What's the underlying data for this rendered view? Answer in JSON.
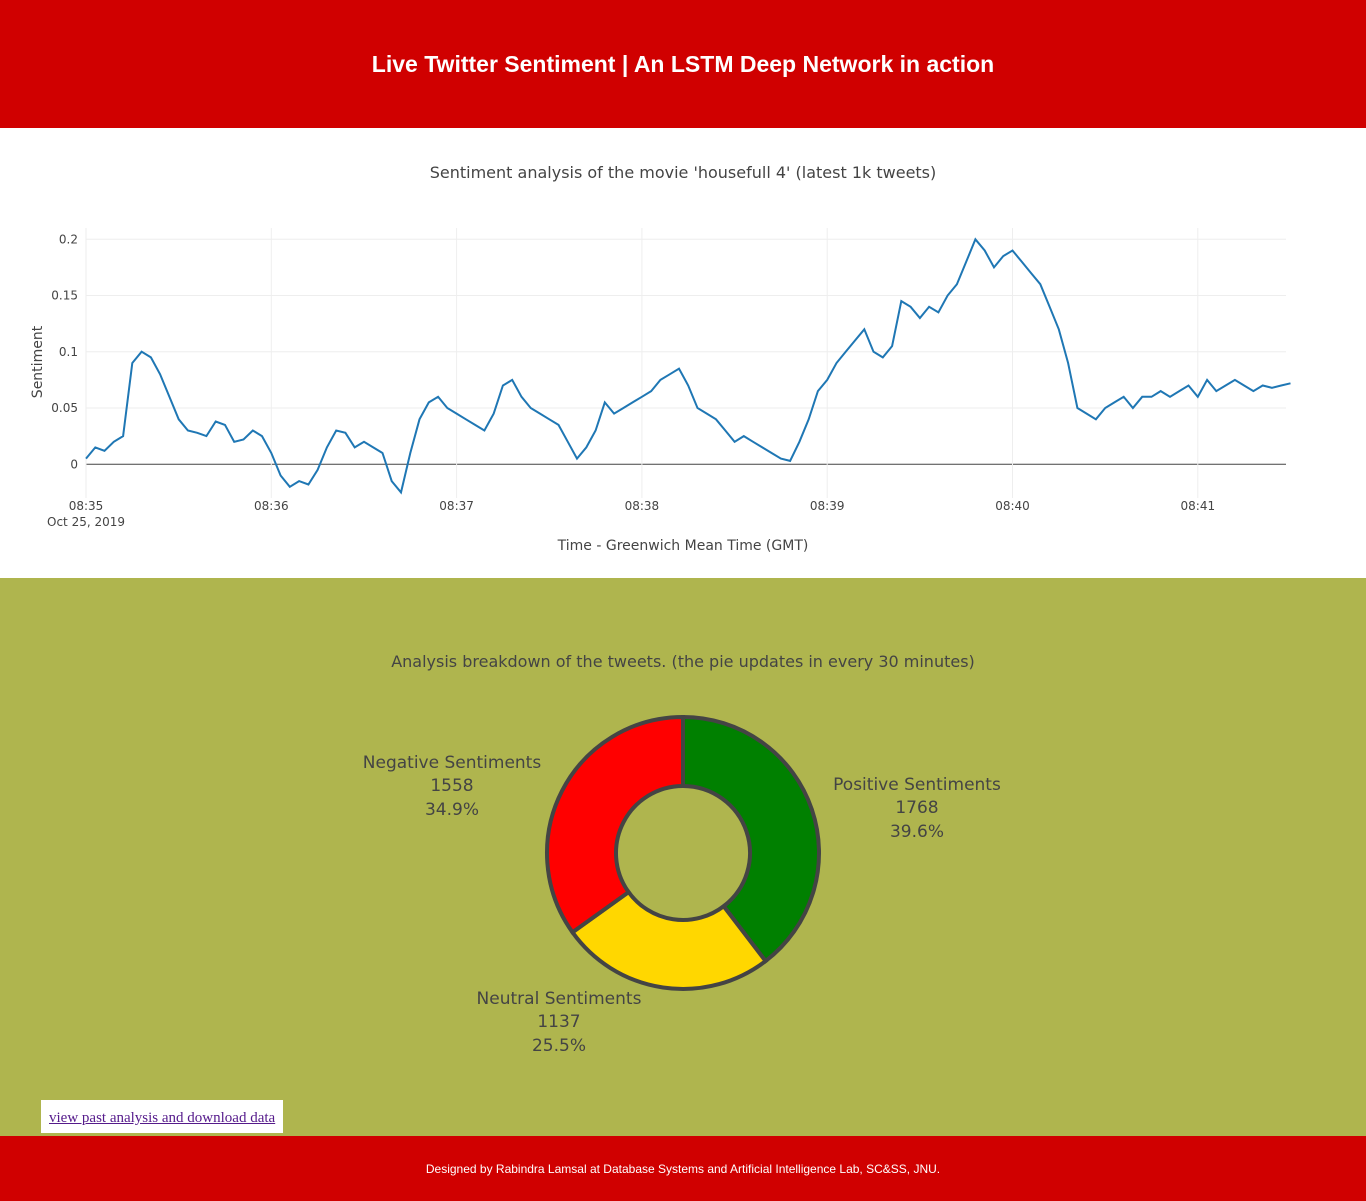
{
  "header": {
    "title": "Live Twitter Sentiment | An LSTM Deep Network in action"
  },
  "colors": {
    "header_bg": "#d00000",
    "line": "#1f77b4",
    "pie_section_bg": "#afb54e",
    "positive": "#008000",
    "neutral": "#ffd700",
    "negative": "#ff0000",
    "slice_border": "#444444"
  },
  "line_chart": {
    "title": "Sentiment analysis of the movie 'housefull 4' (latest 1k tweets)",
    "xlabel": "Time - Greenwich Mean Time (GMT)",
    "ylabel": "Sentiment",
    "date_label": "Oct 25, 2019",
    "xticks": [
      "08:35",
      "08:36",
      "08:37",
      "08:38",
      "08:39",
      "08:40",
      "08:41"
    ],
    "yticks": [
      "0",
      "0.05",
      "0.1",
      "0.15",
      "0.2"
    ]
  },
  "pie_chart": {
    "title": "Analysis breakdown of the tweets. (the pie updates in every 30 minutes)",
    "labels": {
      "positive": [
        "Positive Sentiments",
        "1768",
        "39.6%"
      ],
      "negative": [
        "Negative Sentiments",
        "1558",
        "34.9%"
      ],
      "neutral": [
        "Neutral Sentiments",
        "1137",
        "25.5%"
      ]
    }
  },
  "chart_data": [
    {
      "type": "line",
      "title": "Sentiment analysis of the movie 'housefull 4' (latest 1k tweets)",
      "xlabel": "Time - Greenwich Mean Time (GMT)",
      "ylabel": "Sentiment",
      "xlim": [
        "08:35:00",
        "08:41:30"
      ],
      "ylim": [
        -0.03,
        0.21
      ],
      "grid": true,
      "x": [
        "08:35:00",
        "08:35:03",
        "08:35:06",
        "08:35:09",
        "08:35:12",
        "08:35:15",
        "08:35:18",
        "08:35:21",
        "08:35:24",
        "08:35:27",
        "08:35:30",
        "08:35:33",
        "08:35:36",
        "08:35:39",
        "08:35:42",
        "08:35:45",
        "08:35:48",
        "08:35:51",
        "08:35:54",
        "08:35:57",
        "08:36:00",
        "08:36:03",
        "08:36:06",
        "08:36:09",
        "08:36:12",
        "08:36:15",
        "08:36:18",
        "08:36:21",
        "08:36:24",
        "08:36:27",
        "08:36:30",
        "08:36:33",
        "08:36:36",
        "08:36:39",
        "08:36:42",
        "08:36:45",
        "08:36:48",
        "08:36:51",
        "08:36:54",
        "08:36:57",
        "08:37:00",
        "08:37:03",
        "08:37:06",
        "08:37:09",
        "08:37:12",
        "08:37:15",
        "08:37:18",
        "08:37:21",
        "08:37:24",
        "08:37:27",
        "08:37:30",
        "08:37:33",
        "08:37:36",
        "08:37:39",
        "08:37:42",
        "08:37:45",
        "08:37:48",
        "08:37:51",
        "08:37:54",
        "08:37:57",
        "08:38:00",
        "08:38:03",
        "08:38:06",
        "08:38:09",
        "08:38:12",
        "08:38:15",
        "08:38:18",
        "08:38:21",
        "08:38:24",
        "08:38:27",
        "08:38:30",
        "08:38:33",
        "08:38:36",
        "08:38:39",
        "08:38:42",
        "08:38:45",
        "08:38:48",
        "08:38:51",
        "08:38:54",
        "08:38:57",
        "08:39:00",
        "08:39:03",
        "08:39:06",
        "08:39:09",
        "08:39:12",
        "08:39:15",
        "08:39:18",
        "08:39:21",
        "08:39:24",
        "08:39:27",
        "08:39:30",
        "08:39:33",
        "08:39:36",
        "08:39:39",
        "08:39:42",
        "08:39:45",
        "08:39:48",
        "08:39:51",
        "08:39:54",
        "08:39:57",
        "08:40:00",
        "08:40:03",
        "08:40:06",
        "08:40:09",
        "08:40:12",
        "08:40:15",
        "08:40:18",
        "08:40:21",
        "08:40:24",
        "08:40:27",
        "08:40:30",
        "08:40:33",
        "08:40:36",
        "08:40:39",
        "08:40:42",
        "08:40:45",
        "08:40:48",
        "08:40:51",
        "08:40:54",
        "08:40:57",
        "08:41:00",
        "08:41:03",
        "08:41:06",
        "08:41:09",
        "08:41:12",
        "08:41:15",
        "08:41:18",
        "08:41:21",
        "08:41:24",
        "08:41:27",
        "08:41:30"
      ],
      "y": [
        0.005,
        0.015,
        0.012,
        0.02,
        0.025,
        0.09,
        0.1,
        0.095,
        0.08,
        0.06,
        0.04,
        0.03,
        0.028,
        0.025,
        0.038,
        0.035,
        0.02,
        0.022,
        0.03,
        0.025,
        0.01,
        -0.01,
        -0.02,
        -0.015,
        -0.018,
        -0.005,
        0.015,
        0.03,
        0.028,
        0.015,
        0.02,
        0.015,
        0.01,
        -0.015,
        -0.025,
        0.01,
        0.04,
        0.055,
        0.06,
        0.05,
        0.045,
        0.04,
        0.035,
        0.03,
        0.045,
        0.07,
        0.075,
        0.06,
        0.05,
        0.045,
        0.04,
        0.035,
        0.02,
        0.005,
        0.015,
        0.03,
        0.055,
        0.045,
        0.05,
        0.055,
        0.06,
        0.065,
        0.075,
        0.08,
        0.085,
        0.07,
        0.05,
        0.045,
        0.04,
        0.03,
        0.02,
        0.025,
        0.02,
        0.015,
        0.01,
        0.005,
        0.003,
        0.02,
        0.04,
        0.065,
        0.075,
        0.09,
        0.1,
        0.11,
        0.12,
        0.1,
        0.095,
        0.105,
        0.145,
        0.14,
        0.13,
        0.14,
        0.135,
        0.15,
        0.16,
        0.18,
        0.2,
        0.19,
        0.175,
        0.185,
        0.19,
        0.18,
        0.17,
        0.16,
        0.14,
        0.12,
        0.09,
        0.05,
        0.045,
        0.04,
        0.05,
        0.055,
        0.06,
        0.05,
        0.06,
        0.06,
        0.065,
        0.06,
        0.065,
        0.07,
        0.06,
        0.075,
        0.065,
        0.07,
        0.075,
        0.07,
        0.065,
        0.07,
        0.068,
        0.07,
        0.072
      ]
    },
    {
      "type": "pie",
      "title": "Analysis breakdown of the tweets. (the pie updates in every 30 minutes)",
      "categories": [
        "Positive Sentiments",
        "Neutral Sentiments",
        "Negative Sentiments"
      ],
      "values": [
        1768,
        1137,
        1558
      ],
      "percentages": [
        "39.6%",
        "25.5%",
        "34.9%"
      ],
      "colors": [
        "#008000",
        "#ffd700",
        "#ff0000"
      ],
      "hole": true
    }
  ],
  "footer": {
    "link_label": "view past analysis and download data",
    "credit": "Designed by Rabindra Lamsal at Database Systems and Artificial Intelligence Lab, SC&SS, JNU."
  }
}
